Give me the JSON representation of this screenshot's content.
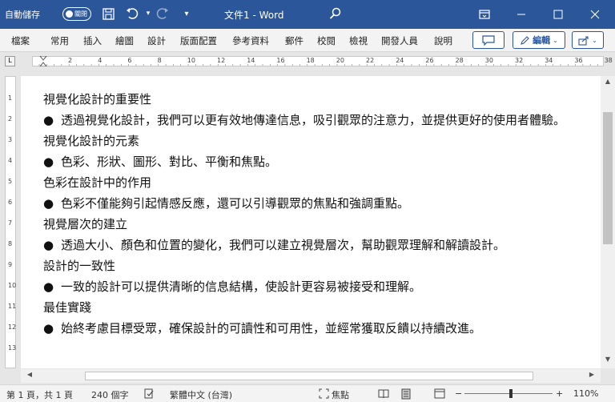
{
  "titlebar": {
    "autosave_label": "自動儲存",
    "autosave_state": "關閉",
    "doc_title": "文件1 - Word",
    "icons": [
      "save-icon",
      "undo-icon",
      "redo-icon",
      "customize-icon",
      "search-icon",
      "ribbon-display-icon",
      "minimize-icon",
      "maximize-icon",
      "close-icon"
    ]
  },
  "ribbon": {
    "tabs": [
      "檔案",
      "常用",
      "插入",
      "繪圖",
      "設計",
      "版面配置",
      "參考資料",
      "郵件",
      "校閱",
      "檢視",
      "開發人員",
      "說明"
    ],
    "comment_button": "",
    "edit_button": "編輯",
    "share_button": ""
  },
  "ruler": {
    "numbers": [
      "2",
      "4",
      "6",
      "8",
      "10",
      "12",
      "14",
      "16",
      "18",
      "20",
      "22",
      "24",
      "26",
      "28",
      "30",
      "32",
      "34",
      "36",
      "38"
    ],
    "vnumbers": [
      "1",
      "2",
      "3",
      "4",
      "5",
      "6",
      "7",
      "8",
      "9",
      "10",
      "11",
      "12",
      "13"
    ]
  },
  "document": {
    "blocks": [
      {
        "type": "heading",
        "text": "視覺化設計的重要性"
      },
      {
        "type": "bullet",
        "text": "透過視覺化設計，我們可以更有效地傳達信息，吸引觀眾的注意力，並提供更好的使用者體驗。"
      },
      {
        "type": "heading",
        "text": "視覺化設計的元素"
      },
      {
        "type": "bullet",
        "text": "色彩、形狀、圖形、對比、平衡和焦點。"
      },
      {
        "type": "heading",
        "text": "色彩在設計中的作用"
      },
      {
        "type": "bullet",
        "text": "色彩不僅能夠引起情感反應，還可以引導觀眾的焦點和強調重點。"
      },
      {
        "type": "heading",
        "text": "視覺層次的建立"
      },
      {
        "type": "bullet",
        "text": "透過大小、顏色和位置的變化，我們可以建立視覺層次，幫助觀眾理解和解讀設計。"
      },
      {
        "type": "heading",
        "text": "設計的一致性"
      },
      {
        "type": "bullet",
        "text": "一致的設計可以提供清晰的信息結構，使設計更容易被接受和理解。"
      },
      {
        "type": "heading",
        "text": "最佳實踐"
      },
      {
        "type": "bullet",
        "text": "始終考慮目標受眾，確保設計的可讀性和可用性，並經常獲取反饋以持續改進。"
      }
    ]
  },
  "statusbar": {
    "page_info": "第 1 頁，共 1 頁",
    "word_count": "240 個字",
    "language": "繁體中文 (台灣)",
    "focus": "焦點",
    "zoom_minus": "−",
    "zoom_plus": "+",
    "zoom": "110%",
    "zoom_value": 1.1
  },
  "colors": {
    "titlebar": "#2b579a",
    "ribbon": "#f3f3f3",
    "workspace": "#e6e6e6"
  }
}
